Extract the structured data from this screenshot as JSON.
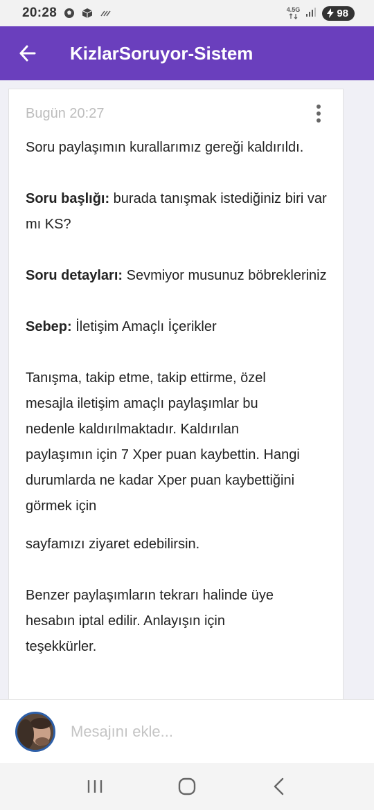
{
  "status_bar": {
    "time": "20:28",
    "network": "4.5G",
    "battery": "98"
  },
  "app_bar": {
    "title": "KizlarSoruyor-Sistem"
  },
  "message": {
    "timestamp": "Bugün 20:27",
    "intro": "Soru paylaşımın kurallarımız gereği kaldırıldı.",
    "title_label": "Soru başlığı:",
    "title_value": " burada tanışmak istediğiniz biri var mı KS?",
    "details_label": "Soru detayları:",
    "details_value": " Sevmiyor musunuz böbrekleriniz",
    "reason_label": "Sebep:",
    "reason_value": " İletişim Amaçlı İçerikler",
    "explanation": "Tanışma, takip etme, takip ettirme, özel mesajla iletişim amaçlı paylaşımlar bu nedenle kaldırılmaktadır. Kaldırılan paylaşımın için 7 Xper puan kaybettin. Hangi durumlarda ne kadar Xper puan kaybettiğini görmek için",
    "visit": "sayfamızı ziyaret edebilirsin.",
    "warning": "Benzer paylaşımların tekrarı halinde üye hesabın iptal edilir. Anlayışın için teşekkürler."
  },
  "composer": {
    "placeholder": "Mesajını ekle..."
  },
  "icons": {
    "back": "arrow-left-icon",
    "more": "more-vertical-icon",
    "nav_recents": "recents-icon",
    "nav_home": "home-icon",
    "nav_back": "chevron-left-icon"
  },
  "colors": {
    "app_bar": "#6a3fbd",
    "background": "#f0f0f6"
  }
}
